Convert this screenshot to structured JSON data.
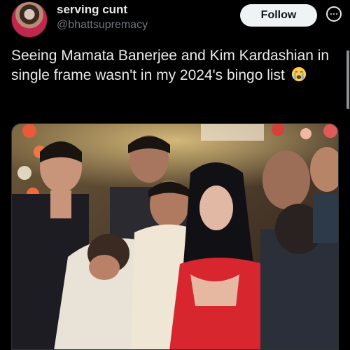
{
  "tweet": {
    "display_name": "serving cunt",
    "handle": "@bhattsupremacy",
    "follow_label": "Follow",
    "text": "Seeing Mamata Banerjee and Kim Kardashian in single frame wasn't in my 2024's bingo list",
    "emoji": "loudly-crying-face-emoji"
  },
  "icons": {
    "more": "more-options-icon",
    "avatar": "avatar"
  },
  "media": {
    "type": "photo"
  },
  "colors": {
    "background": "#000000",
    "text": "#e7e9ea",
    "secondary_text": "#71767b",
    "follow_button_bg": "#eff3f4",
    "follow_button_text": "#0f1419"
  }
}
